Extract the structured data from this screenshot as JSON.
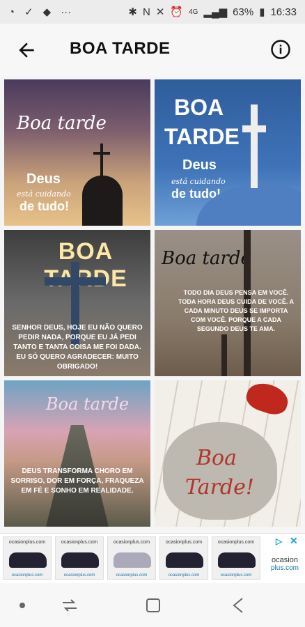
{
  "status_bar": {
    "battery": "63%",
    "time": "16:33",
    "network": "4G"
  },
  "app_bar": {
    "title": "BOA TARDE"
  },
  "tiles": [
    {
      "heading": "Boa tarde",
      "line1": "Deus",
      "line2": "está cuidando",
      "line3": "de tudo!"
    },
    {
      "heading1": "BOA",
      "heading2": "TARDE",
      "line1": "Deus",
      "line2": "está cuidando",
      "line3": "de tudo!"
    },
    {
      "heading": "BOA TARDE",
      "body": "SENHOR DEUS, HOJE EU NÃO QUERO PEDIR NADA, PORQUE EU JÁ PEDI TANTO E TANTA COISA ME FOI DADA. EU SÓ QUERO AGRADECER: MUITO OBRIGADO!"
    },
    {
      "heading": "Boa tarde",
      "body": "TODO DIA DEUS PENSA EM VOCÊ. TODA HORA DEUS CUIDA DE VOCÊ. A CADA MINUTO DEUS SE IMPORTA COM VOCÊ. PORQUE A CADA SEGUNDO DEUS TE AMA."
    },
    {
      "heading": "Boa tarde",
      "body": "DEUS TRANSFORMA CHORO EM SORRISO, DOR EM FORÇA, FRAQUEZA EM FÉ E SONHO EM REALIDADE."
    },
    {
      "line1": "Boa",
      "line2": "Tarde!"
    }
  ],
  "ad": {
    "brand": "ocasionplus.com",
    "url": "ocasionplus.com",
    "logo_line1": "ocasion",
    "logo_line2": "plus.com"
  }
}
